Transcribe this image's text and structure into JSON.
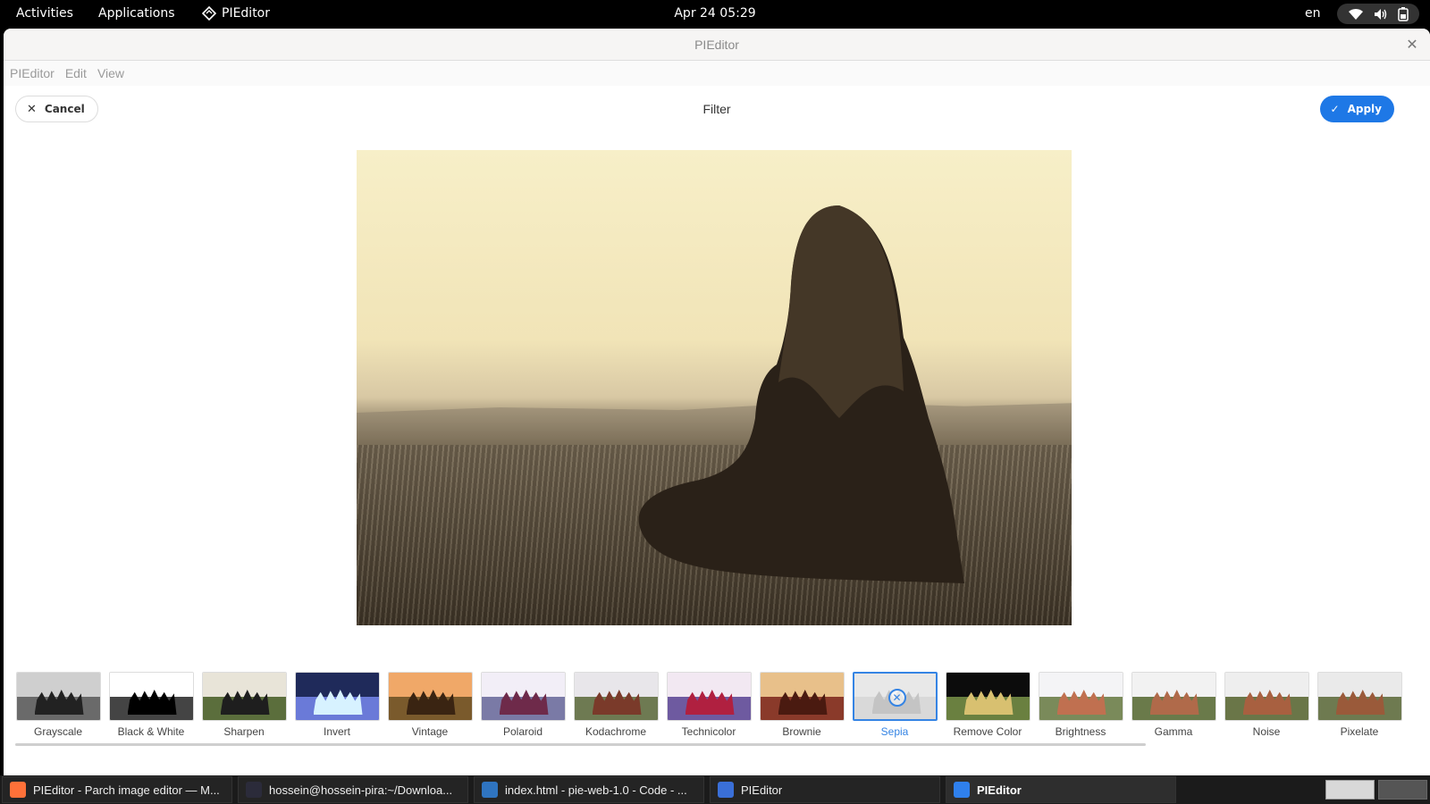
{
  "topbar": {
    "activities": "Activities",
    "applications": "Applications",
    "app_name": "PIEditor",
    "clock": "Apr 24  05:29",
    "language": "en"
  },
  "window": {
    "title": "PIEditor",
    "menu": [
      "PIEditor",
      "Edit",
      "View"
    ]
  },
  "toolbar": {
    "cancel_label": "Cancel",
    "title": "Filter",
    "apply_label": "Apply",
    "accent": "#1e78e6"
  },
  "filters": [
    {
      "label": "Grayscale",
      "sky": "#cfcfcf",
      "ground": "#6a6a6a",
      "figs": "#222222"
    },
    {
      "label": "Black & White",
      "sky": "#ffffff",
      "ground": "#444444",
      "figs": "#000000"
    },
    {
      "label": "Sharpen",
      "sky": "#e8e4d8",
      "ground": "#5b6e3c",
      "figs": "#1e1e1e"
    },
    {
      "label": "Invert",
      "sky": "#1f2a5a",
      "ground": "#6a7ad8",
      "figs": "#d7f2ff"
    },
    {
      "label": "Vintage",
      "sky": "#f0a868",
      "ground": "#7a5a2c",
      "figs": "#3a2412"
    },
    {
      "label": "Polaroid",
      "sky": "#f2eef7",
      "ground": "#7a7aa6",
      "figs": "#6e2a4a"
    },
    {
      "label": "Kodachrome",
      "sky": "#e8e6ea",
      "ground": "#6e7a52",
      "figs": "#7a3a2a"
    },
    {
      "label": "Technicolor",
      "sky": "#f2e8f2",
      "ground": "#6e5aa0",
      "figs": "#b02040"
    },
    {
      "label": "Brownie",
      "sky": "#e8c08a",
      "ground": "#8a3a2a",
      "figs": "#4a1a10"
    },
    {
      "label": "Sepia",
      "sky": "#e8e8e8",
      "ground": "#d9d9d9",
      "figs": "#c4c4c4"
    },
    {
      "label": "Remove Color",
      "sky": "#0c0c0c",
      "ground": "#6a8040",
      "figs": "#d8c070"
    },
    {
      "label": "Brightness",
      "sky": "#f4f4f6",
      "ground": "#7a8a5a",
      "figs": "#c07050"
    },
    {
      "label": "Gamma",
      "sky": "#f2f2f2",
      "ground": "#6a7a4a",
      "figs": "#b06a4a"
    },
    {
      "label": "Noise",
      "sky": "#eeeeee",
      "ground": "#6a7648",
      "figs": "#a86040"
    },
    {
      "label": "Pixelate",
      "sky": "#eaeaea",
      "ground": "#6e7a50",
      "figs": "#9a5a3a"
    }
  ],
  "selected_filter": "Sepia",
  "taskbar": {
    "tasks": [
      {
        "label": "PIEditor - Parch image editor — M...",
        "icon_color": "#ff7139",
        "icon": "firefox-icon"
      },
      {
        "label": "hossein@hossein-pira:~/Downloa...",
        "icon_color": "#2b2b3a",
        "icon": "terminal-icon"
      },
      {
        "label": "index.html - pie-web-1.0 - Code - ...",
        "icon_color": "#2f74c0",
        "icon": "vscode-icon"
      },
      {
        "label": "PIEditor",
        "icon_color": "#3a6fd8",
        "icon": "document-icon"
      },
      {
        "label": "PIEditor",
        "icon_color": "#2f80ed",
        "icon": "pieditor-icon"
      }
    ]
  }
}
